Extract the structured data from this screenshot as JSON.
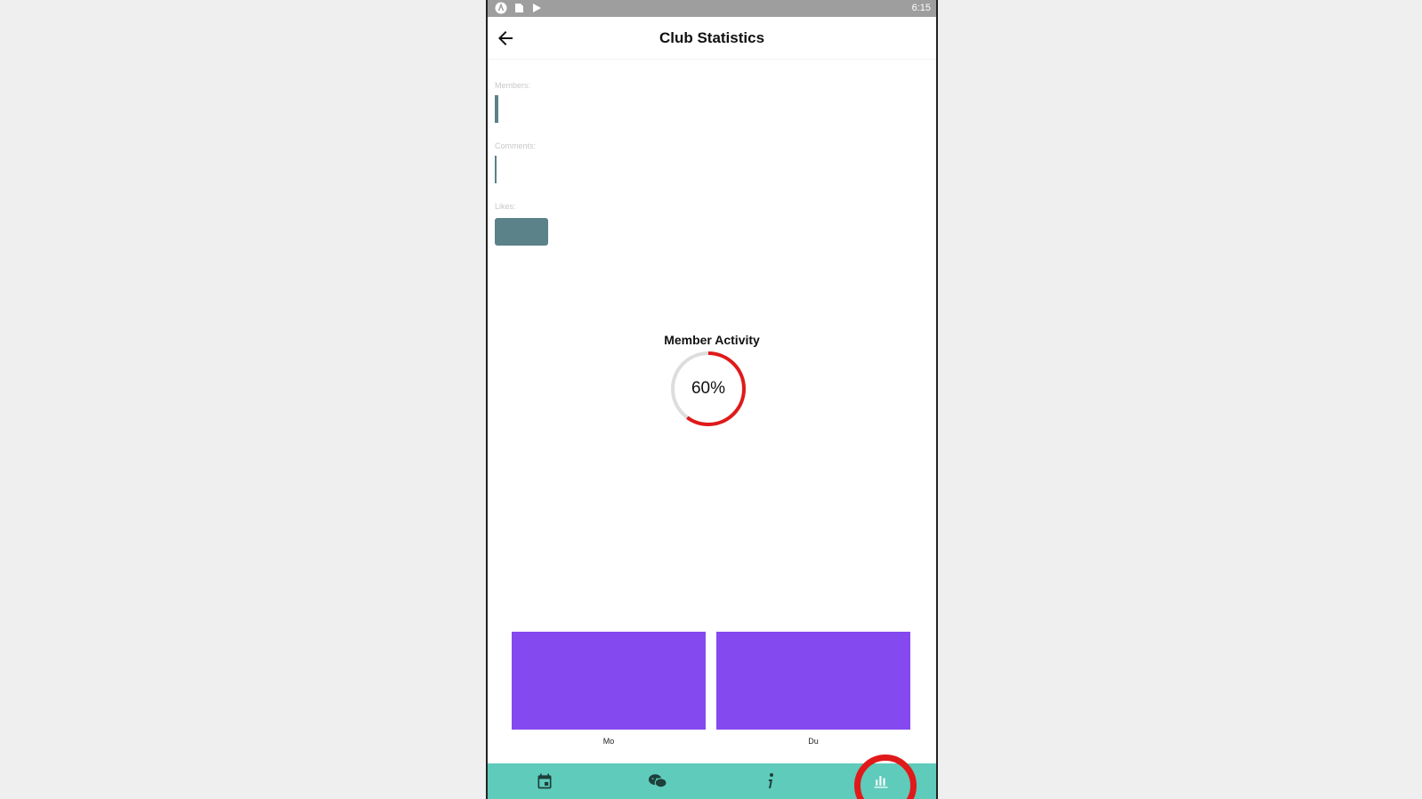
{
  "status_bar": {
    "time": "6:15",
    "icons": [
      "app-notification-icon",
      "sd-card-icon",
      "play-store-icon"
    ]
  },
  "app_bar": {
    "title": "Club Statistics",
    "back_icon": "arrow-back-icon"
  },
  "stats": [
    {
      "label": "Members:",
      "value": 1
    },
    {
      "label": "Comments:",
      "value": 0
    },
    {
      "label": "Likes:",
      "value": 12
    }
  ],
  "member_activity": {
    "title": "Member Activity",
    "value_text": "60%",
    "progress": 0.6,
    "progress_color": "#e01a1a",
    "track_color": "#dddddd"
  },
  "chart_data": {
    "type": "bar",
    "categories": [
      "Mo",
      "Du"
    ],
    "values": [
      1,
      1
    ],
    "color": "#8549f0"
  },
  "bottom_nav": {
    "background": "#5ecbbb",
    "items": [
      {
        "icon": "calendar-icon"
      },
      {
        "icon": "chat-bubbles-icon"
      },
      {
        "icon": "info-icon"
      },
      {
        "icon": "bar-chart-icon",
        "selected": true
      }
    ]
  },
  "annotation": {
    "highlight_color": "#e01a1a",
    "target": "bar-chart-icon"
  }
}
